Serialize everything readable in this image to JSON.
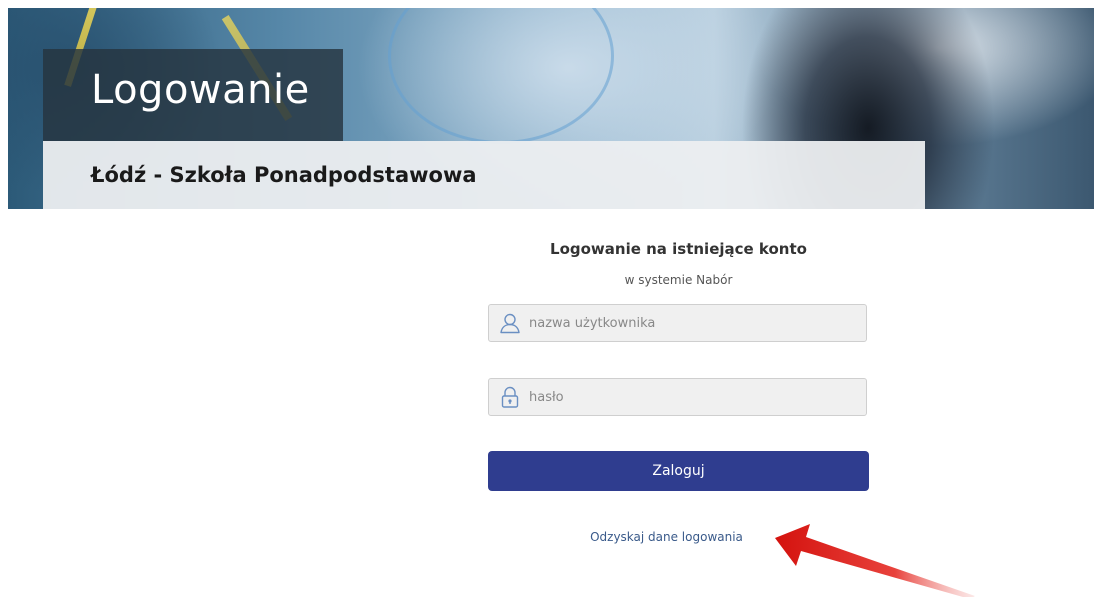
{
  "header": {
    "title": "Logowanie",
    "subtitle": "Łódź - Szkoła Ponadpodstawowa"
  },
  "form": {
    "heading": "Logowanie na istniejące konto",
    "subheading": "w systemie Nabór",
    "username": {
      "placeholder": "nazwa użytkownika",
      "value": "",
      "icon": "user-icon"
    },
    "password": {
      "placeholder": "hasło",
      "value": "",
      "icon": "lock-icon"
    },
    "submit_label": "Zaloguj",
    "recover_link": "Odzyskaj dane logowania"
  },
  "colors": {
    "primary_button": "#2f3d8f",
    "link": "#3a5a8a",
    "annotation_arrow": "#e3201b"
  }
}
